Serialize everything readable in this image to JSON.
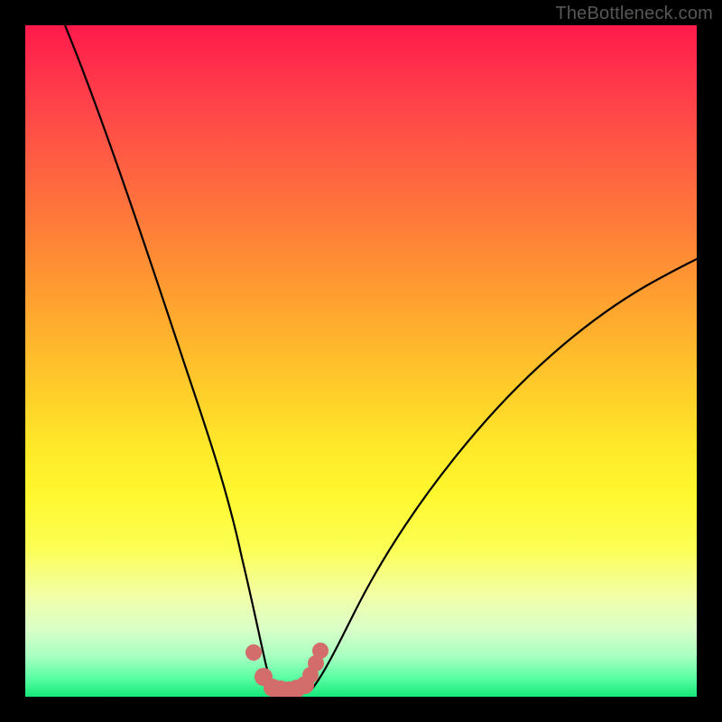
{
  "watermark": "TheBottleneck.com",
  "chart_data": {
    "type": "line",
    "title": "",
    "xlabel": "",
    "ylabel": "",
    "xlim": [
      0,
      100
    ],
    "ylim": [
      0,
      100
    ],
    "grid": false,
    "legend": false,
    "series": [
      {
        "name": "left-curve",
        "x": [
          6,
          10,
          15,
          20,
          24,
          27,
          30,
          32,
          33.5,
          34.5,
          35.5,
          36.5
        ],
        "y": [
          100,
          85,
          66,
          49,
          36,
          26,
          16,
          9.5,
          5.5,
          3.2,
          1.8,
          1.2
        ]
      },
      {
        "name": "right-curve",
        "x": [
          42,
          44,
          47,
          51,
          56,
          63,
          72,
          82,
          92,
          100
        ],
        "y": [
          1.4,
          3.0,
          6.5,
          12,
          19,
          28,
          39,
          50,
          59,
          65
        ]
      },
      {
        "name": "valley-floor",
        "x": [
          36.5,
          37.5,
          38.5,
          39.5,
          40.5,
          42
        ],
        "y": [
          1.2,
          0.9,
          0.8,
          0.8,
          0.9,
          1.4
        ]
      }
    ],
    "markers": {
      "name": "salmon-markers",
      "color": "#d36d6c",
      "points": [
        {
          "x": 34.0,
          "y": 6.6
        },
        {
          "x": 35.5,
          "y": 3.0
        },
        {
          "x": 36.8,
          "y": 1.4
        },
        {
          "x": 38.0,
          "y": 1.1
        },
        {
          "x": 39.2,
          "y": 1.0
        },
        {
          "x": 40.4,
          "y": 1.2
        },
        {
          "x": 41.6,
          "y": 1.8
        },
        {
          "x": 42.5,
          "y": 3.2
        },
        {
          "x": 43.3,
          "y": 5.0
        },
        {
          "x": 44.0,
          "y": 6.9
        }
      ]
    },
    "background_gradient": {
      "top_color": "#ff1a4b",
      "bottom_color": "#15e87a"
    }
  }
}
